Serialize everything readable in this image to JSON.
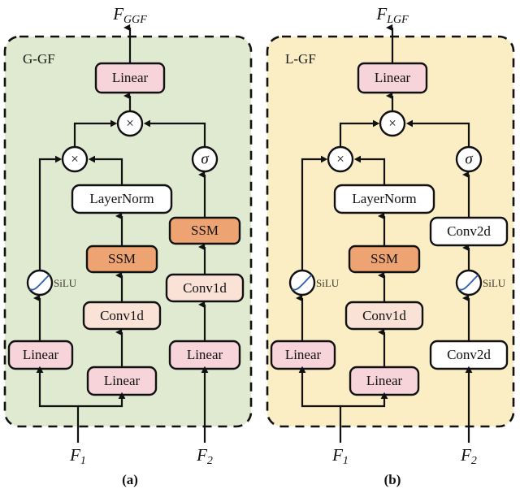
{
  "figure": {
    "caption_a": "(a)",
    "caption_b": "(b)",
    "colors": {
      "panel_a_fill": "#dfead0",
      "panel_b_fill": "#fbeec4",
      "linear_fill": "#f6d4da",
      "conv1d_fill": "#fae3d6",
      "ssm_fill": "#eea472",
      "white_fill": "#ffffff",
      "curve_stroke": "#2d5fa8",
      "line_stroke": "#111111"
    }
  },
  "panels": [
    {
      "id": "a",
      "tag": "G-GF",
      "caption": "(a)",
      "output_label": "F",
      "output_sub": "GGF",
      "inputs": [
        {
          "label": "F",
          "sub": "1"
        },
        {
          "label": "F",
          "sub": "2"
        }
      ],
      "nodes": {
        "top_linear": "Linear",
        "outer_mul": "×",
        "inner_mul": "×",
        "sigma": "σ",
        "layernorm": "LayerNorm",
        "left_silu": "SiLU",
        "left_linear": "Linear",
        "mid_ssm": "SSM",
        "mid_conv": "Conv1d",
        "mid_linear": "Linear",
        "right_ssm": "SSM",
        "right_conv": "Conv1d",
        "right_linear": "Linear"
      }
    },
    {
      "id": "b",
      "tag": "L-GF",
      "caption": "(b)",
      "output_label": "F",
      "output_sub": "LGF",
      "inputs": [
        {
          "label": "F",
          "sub": "1"
        },
        {
          "label": "F",
          "sub": "2"
        }
      ],
      "nodes": {
        "top_linear": "Linear",
        "outer_mul": "×",
        "inner_mul": "×",
        "sigma": "σ",
        "layernorm": "LayerNorm",
        "left_silu": "SiLU",
        "left_linear": "Linear",
        "mid_ssm": "SSM",
        "mid_conv": "Conv1d",
        "mid_linear": "Linear",
        "right_top_conv": "Conv2d",
        "right_silu": "SiLU",
        "right_bottom_conv": "Conv2d"
      }
    }
  ]
}
